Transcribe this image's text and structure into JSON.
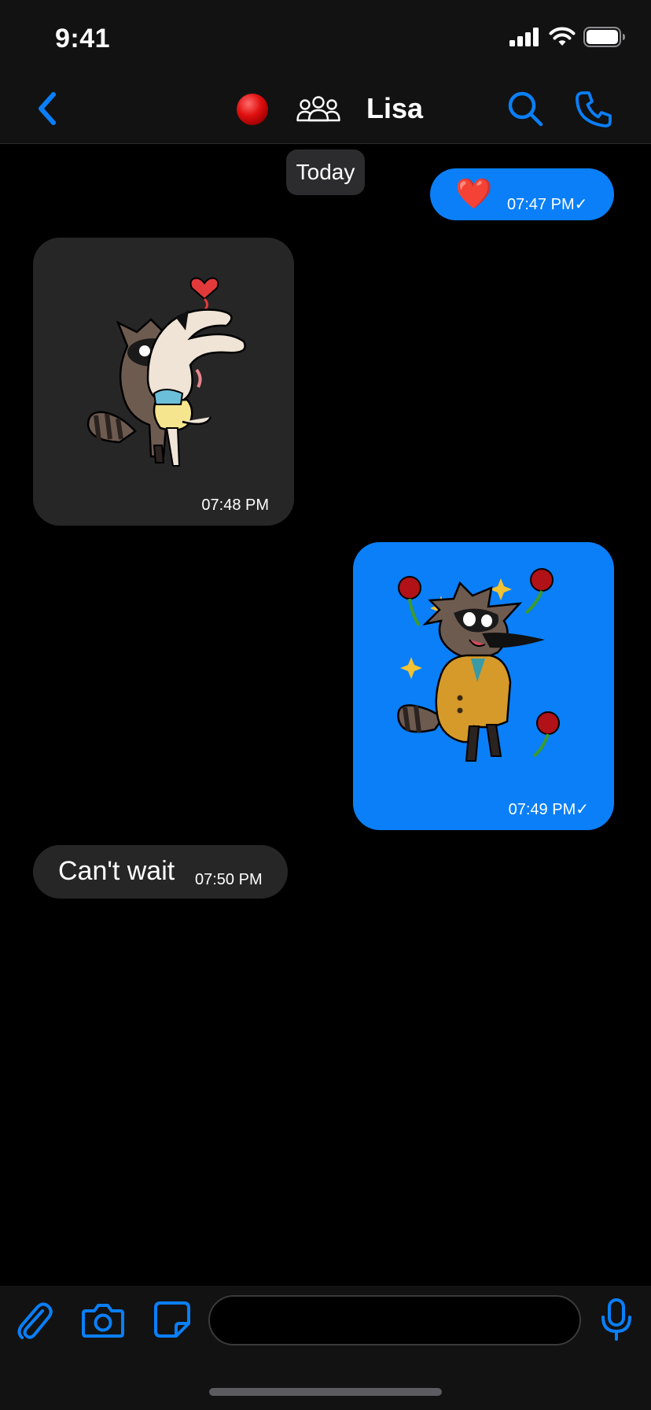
{
  "status_bar": {
    "time": "9:41",
    "icons": [
      "cellular-signal-icon",
      "wifi-icon",
      "battery-icon"
    ]
  },
  "header": {
    "back_icon": "chevron-left-icon",
    "status_icon": "red-dot-icon",
    "group_icon": "group-people-icon",
    "title": "Lisa",
    "search_icon": "search-icon",
    "call_icon": "phone-icon"
  },
  "chat": {
    "date_label": "Today",
    "messages": [
      {
        "direction": "outgoing",
        "type": "emoji",
        "content": "❤️",
        "time": "07:47 PM✓"
      },
      {
        "direction": "incoming",
        "type": "sticker",
        "sticker": "raccoon-hugging-bunny-sticker",
        "time": "07:48 PM"
      },
      {
        "direction": "outgoing",
        "type": "sticker",
        "sticker": "raccoon-in-coat-with-roses-sticker",
        "time": "07:49 PM✓"
      },
      {
        "direction": "incoming",
        "type": "text",
        "content": "Can't wait",
        "time": "07:50 PM"
      }
    ]
  },
  "composer": {
    "icons": [
      "paperclip-icon",
      "camera-icon",
      "sticker-icon",
      "microphone-icon"
    ],
    "input_value": "",
    "input_placeholder": ""
  },
  "colors": {
    "accent": "#0a7ff8",
    "incoming_bubble": "#262626",
    "bar_background": "#121212",
    "background": "#000000"
  }
}
